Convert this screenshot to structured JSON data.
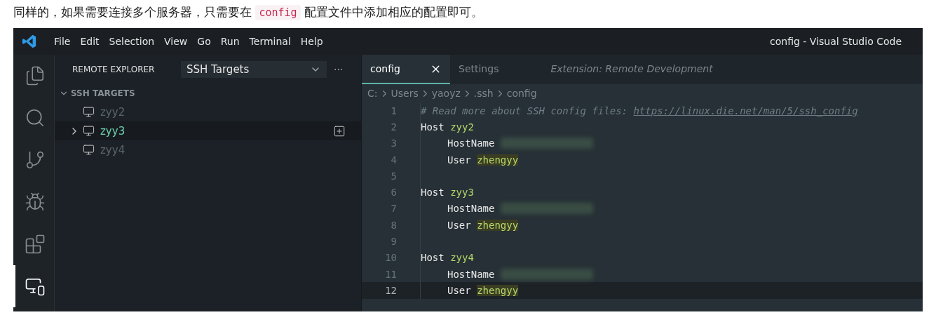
{
  "intro": [
    {
      "kind": "text",
      "text": "同样的，如果需要连接多个服务器，只需要在 "
    },
    {
      "kind": "code",
      "text": "config"
    },
    {
      "kind": "text",
      "text": " 配置文件中添加相应的配置即可。"
    }
  ],
  "window": {
    "title": "config - Visual Studio Code",
    "menu": [
      "File",
      "Edit",
      "Selection",
      "View",
      "Go",
      "Run",
      "Terminal",
      "Help"
    ]
  },
  "activity_bar": [
    {
      "kind": "files",
      "selected": false
    },
    {
      "kind": "search",
      "selected": false
    },
    {
      "kind": "source-control",
      "selected": false
    },
    {
      "kind": "run-debug",
      "selected": false
    },
    {
      "kind": "extensions",
      "selected": false
    },
    {
      "kind": "remote",
      "selected": true
    }
  ],
  "sidebar": {
    "title": "REMOTE EXPLORER",
    "dropdown": "SSH Targets",
    "more": "···",
    "section": {
      "label": "SSH TARGETS",
      "expanded": true,
      "items": [
        {
          "label": "zyy2",
          "selected": false
        },
        {
          "label": "zyy3",
          "selected": true
        },
        {
          "label": "zyy4",
          "selected": false
        }
      ]
    }
  },
  "tabs": [
    {
      "label": "config",
      "selected": true,
      "preview": false
    },
    {
      "label": "Settings",
      "selected": false,
      "preview": false
    },
    {
      "label": "Extension: Remote Development",
      "selected": false,
      "preview": true
    }
  ],
  "breadcrumb": [
    "C:",
    "Users",
    "yaoyz",
    ".ssh",
    "config"
  ],
  "code": [
    {
      "number": "1",
      "indented": false,
      "current": false,
      "tokens": [
        {
          "kind": "comment",
          "text": "# Read more about SSH config files: "
        },
        {
          "kind": "link",
          "text": "https://linux.die.net/man/5/ssh_config"
        }
      ]
    },
    {
      "number": "2",
      "indented": false,
      "current": false,
      "tokens": [
        {
          "kind": "keyword",
          "text": "Host "
        },
        {
          "kind": "value",
          "text": "zyy2"
        }
      ]
    },
    {
      "number": "3",
      "indented": true,
      "current": false,
      "tokens": [
        {
          "kind": "keyword",
          "text": "HostName "
        },
        {
          "kind": "redacted"
        }
      ]
    },
    {
      "number": "4",
      "indented": true,
      "current": false,
      "tokens": [
        {
          "kind": "keyword",
          "text": "User "
        },
        {
          "kind": "match",
          "text": "zhengyy"
        }
      ]
    },
    {
      "number": "5",
      "current": false
    },
    {
      "number": "6",
      "indented": false,
      "current": false,
      "tokens": [
        {
          "kind": "keyword",
          "text": "Host "
        },
        {
          "kind": "value",
          "text": "zyy3"
        }
      ]
    },
    {
      "number": "7",
      "indented": true,
      "current": false,
      "tokens": [
        {
          "kind": "keyword",
          "text": "HostName "
        },
        {
          "kind": "redacted"
        }
      ]
    },
    {
      "number": "8",
      "indented": true,
      "current": false,
      "tokens": [
        {
          "kind": "keyword",
          "text": "User "
        },
        {
          "kind": "match",
          "text": "zhengyy"
        }
      ]
    },
    {
      "number": "9",
      "current": false
    },
    {
      "number": "10",
      "indented": false,
      "current": false,
      "tokens": [
        {
          "kind": "keyword",
          "text": "Host "
        },
        {
          "kind": "value",
          "text": "zyy4"
        }
      ]
    },
    {
      "number": "11",
      "indented": true,
      "current": false,
      "tokens": [
        {
          "kind": "keyword",
          "text": "HostName "
        },
        {
          "kind": "redacted"
        }
      ]
    },
    {
      "number": "12",
      "indented": true,
      "current": true,
      "tokens": [
        {
          "kind": "keyword",
          "text": "User "
        },
        {
          "kind": "match",
          "text": "zhengyy"
        }
      ]
    }
  ]
}
